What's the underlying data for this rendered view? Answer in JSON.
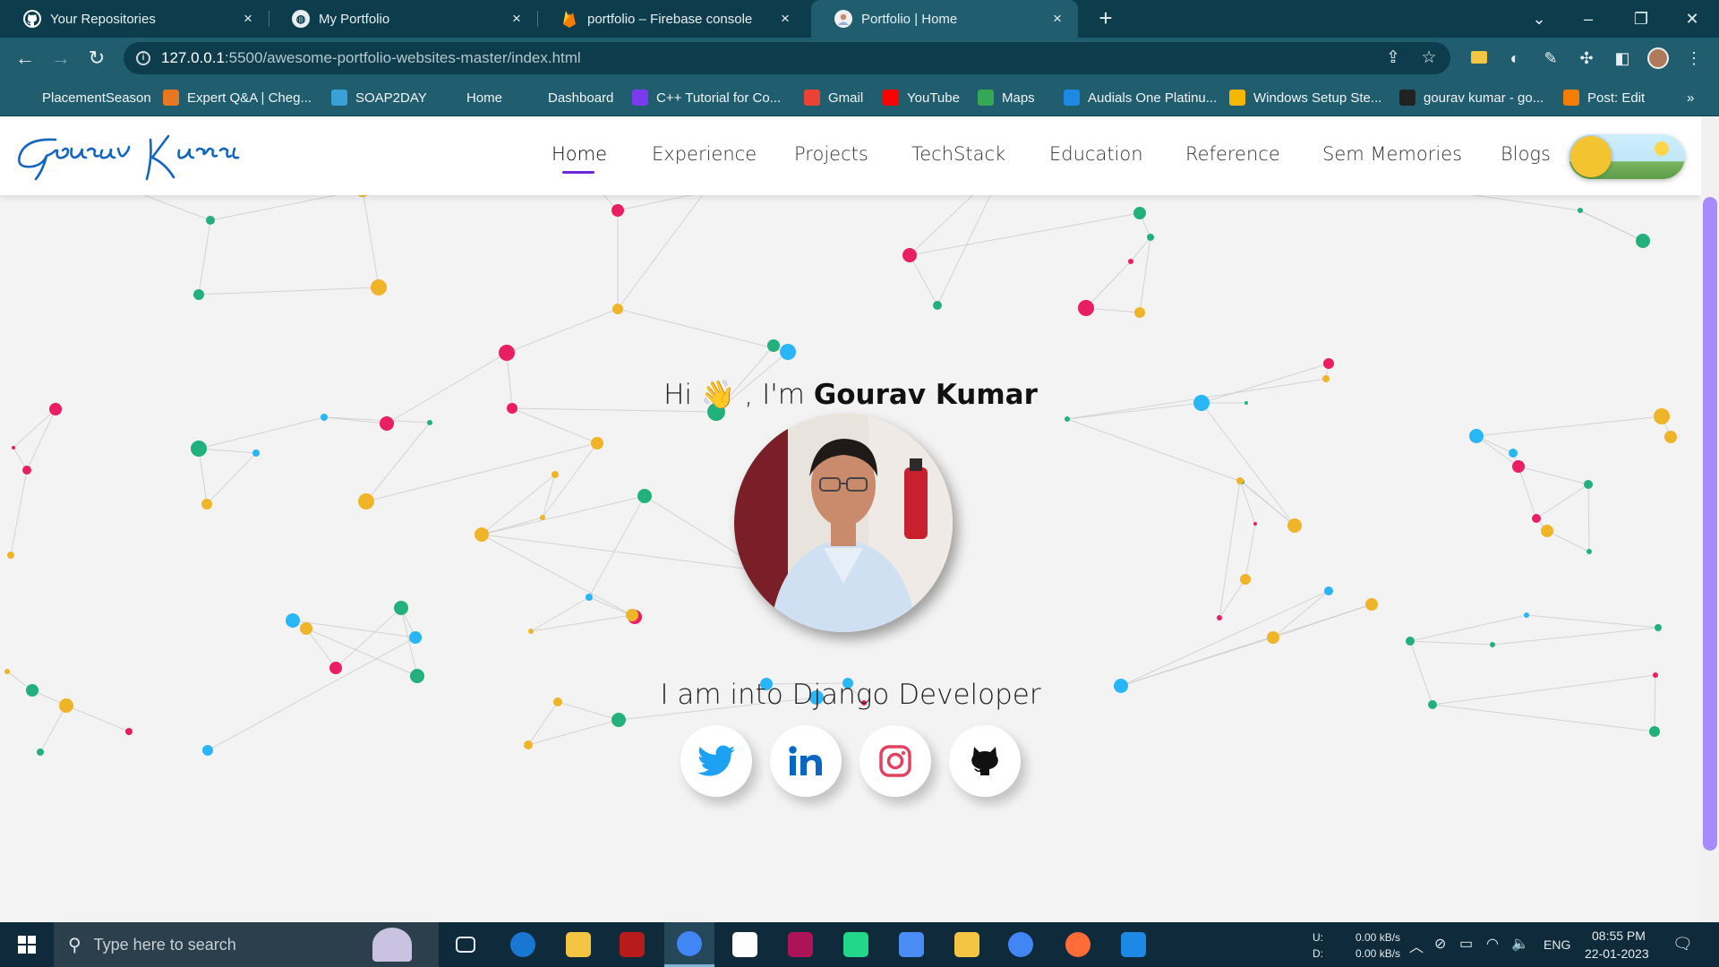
{
  "browser": {
    "tabs": [
      {
        "title": "Your Repositories",
        "icon": "github-icon"
      },
      {
        "title": "My Portfolio",
        "icon": "globe-icon"
      },
      {
        "title": "portfolio – Firebase console",
        "icon": "firebase-icon"
      },
      {
        "title": "Portfolio | Home",
        "icon": "avatar-icon",
        "active": true
      }
    ],
    "url_host": "127.0.0.1",
    "url_path": ":5500/awesome-portfolio-websites-master/index.html",
    "bookmarks": [
      {
        "label": "PlacementSeason",
        "icon": "placement-icon",
        "color": "#1f5d6f"
      },
      {
        "label": "Expert Q&A | Cheg...",
        "icon": "chegg-icon",
        "color": "#e87722"
      },
      {
        "label": "SOAP2DAY",
        "icon": "soap2day-icon",
        "color": "#3aa0d8"
      },
      {
        "label": "Home",
        "icon": "globe-icon",
        "color": "#1f5d6f"
      },
      {
        "label": "Dashboard",
        "icon": "globe-icon",
        "color": "#1f5d6f"
      },
      {
        "label": "C++ Tutorial for Co...",
        "icon": "tutorial-icon",
        "color": "#7c3aed"
      },
      {
        "label": "Gmail",
        "icon": "gmail-icon",
        "color": "#ea4335"
      },
      {
        "label": "YouTube",
        "icon": "youtube-icon",
        "color": "#ff0000"
      },
      {
        "label": "Maps",
        "icon": "maps-icon",
        "color": "#34a853"
      },
      {
        "label": "Audials One Platinu...",
        "icon": "audials-icon",
        "color": "#1e88e5"
      },
      {
        "label": "Windows Setup Ste...",
        "icon": "windows-setup-icon",
        "color": "#f5b700"
      },
      {
        "label": "gourav kumar - go...",
        "icon": "hackerrank-icon",
        "color": "#222222"
      },
      {
        "label": "Post: Edit",
        "icon": "blogger-icon",
        "color": "#f57d00"
      }
    ]
  },
  "site": {
    "logo_text": "Gourav Kumar",
    "nav": [
      {
        "label": "Home",
        "active": true
      },
      {
        "label": "Experience"
      },
      {
        "label": "Projects"
      },
      {
        "label": "TechStack"
      },
      {
        "label": "Education"
      },
      {
        "label": "Reference"
      },
      {
        "label": "Sem Memories"
      },
      {
        "label": "Blogs"
      }
    ],
    "greeting_prefix": "Hi",
    "greeting_emoji": "👋",
    "greeting_mid": ", I'm",
    "name": "Gourav Kumar",
    "tagline": "I am into Django Developer",
    "socials": [
      {
        "name": "twitter",
        "color": "#1da1f2"
      },
      {
        "name": "linkedin",
        "color": "#0a66c2"
      },
      {
        "name": "instagram",
        "color": "#e4405f"
      },
      {
        "name": "github",
        "color": "#111111"
      }
    ],
    "accent": "#6d28d9",
    "network_colors": [
      "#e91e63",
      "#f0b429",
      "#22b07d",
      "#29b6f6"
    ]
  },
  "taskbar": {
    "search_placeholder": "Type here to search",
    "net_up_label": "U:",
    "net_down_label": "D:",
    "net_up": "0.00 kB/s",
    "net_down": "0.00 kB/s",
    "language": "ENG",
    "time": "08:55 PM",
    "date": "22-01-2023",
    "apps": [
      "task-view",
      "edge",
      "file-explorer",
      "app",
      "chrome",
      "slack",
      "intellij",
      "pycharm",
      "goland",
      "sticky-notes",
      "chrome-2",
      "postman",
      "vscode"
    ]
  }
}
